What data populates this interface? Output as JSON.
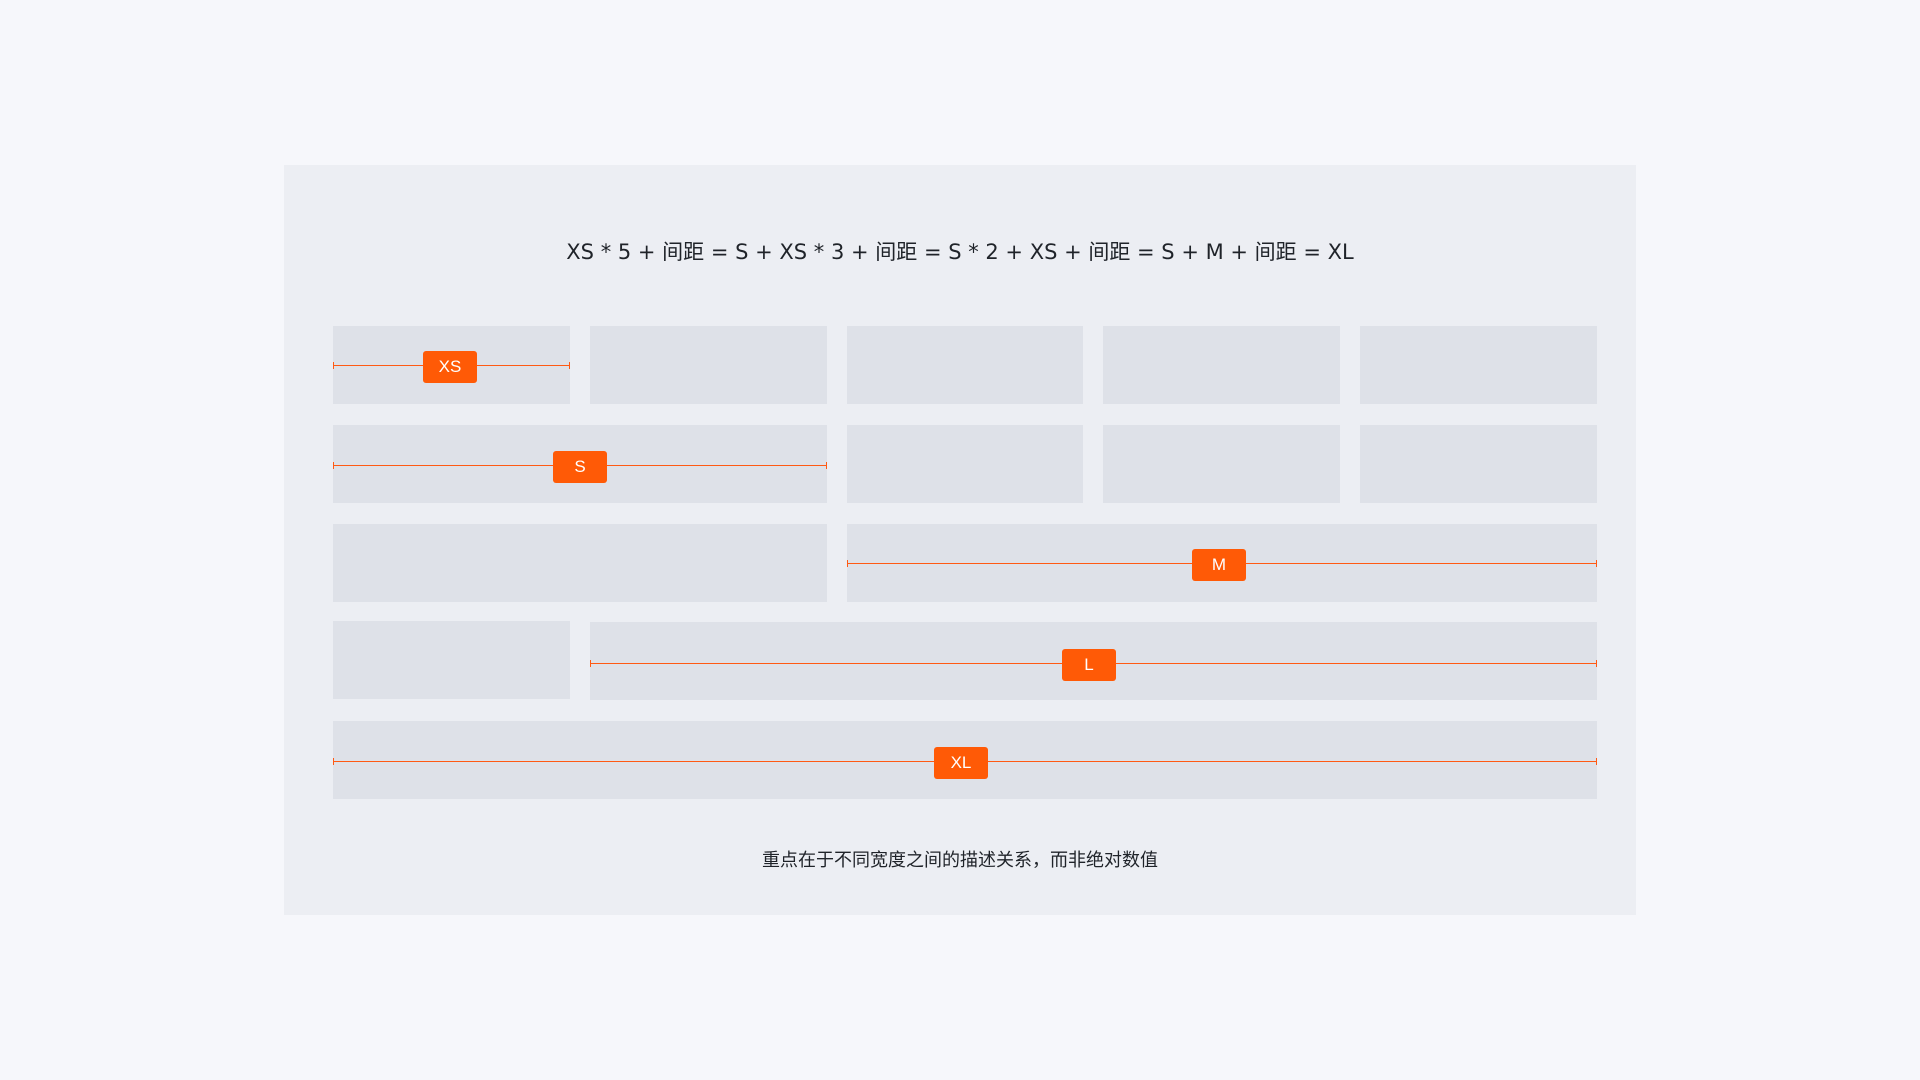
{
  "formula": "XS * 5 + 间距 = S + XS * 3 + 间距 = S * 2 + XS + 间距 = S + M + 间距 = XL",
  "footnote": "重点在于不同宽度之间的描述关系，而非绝对数值",
  "labels": {
    "xs": "XS",
    "s": "S",
    "m": "M",
    "l": "L",
    "xl": "XL"
  },
  "colors": {
    "page_background": "#f6f7fb",
    "panel_background": "#eceef3",
    "block": "#dee1e8",
    "accent": "#ff5a06",
    "text": "#1f2329"
  }
}
